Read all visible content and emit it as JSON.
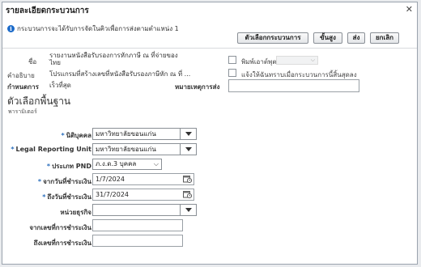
{
  "dialog": {
    "title": "รายละเอียดกระบวนการ",
    "close_glyph": "✕"
  },
  "info": {
    "icon_glyph": "i",
    "text": "กระบวนการจะได้รับการจัดในคิวเพื่อการส่งตามตำแหน่ง 1"
  },
  "buttons": {
    "process_options": "ตัวเลือกกระบวนการ",
    "advanced": "ขั้นสูง",
    "submit": "ส่ง",
    "cancel": "ยกเลิก"
  },
  "details": {
    "name_label": "ชื่อ",
    "name_value": "รายงานหนังสือรับรองการหักภาษี ณ ที่จ่ายของไทย",
    "description_label": "คำอธิบาย",
    "description_value": "โปรแกรมที่สร้างเลขที่หนังสือรับรองภาษีหัก ณ ที่ ...",
    "schedule_label": "กำหนดการ",
    "schedule_value": "เร็วที่สุด",
    "print_output_label": "พิมพ์เอาต์พุต",
    "notify_label": "แจ้งให้ฉันทราบเมื่อกระบวนการนี้สิ้นสุดลง",
    "submission_notes_label": "หมายเหตุการส่ง",
    "submission_notes_value": ""
  },
  "basic_options": {
    "title": "ตัวเลือกพื้นฐาน",
    "subtitle": "พารามิเตอร์"
  },
  "params": {
    "required_marker": "*",
    "legal_entity_label": "นิติบุคคล",
    "legal_entity_value": "มหาวิทยาลัยขอนแก่น",
    "lru_label": "Legal Reporting Unit",
    "lru_value": "มหาวิทยาลัยขอนแก่น",
    "pnd_type_label": "ประเภท PND",
    "pnd_type_value": "ภ.ง.ด.3 บุคคล",
    "from_payment_date_label": "จากวันที่ชำระเงิน",
    "from_payment_date_value": "1/7/2024",
    "to_payment_date_label": "ถึงวันที่ชำระเงิน",
    "to_payment_date_value": "31/7/2024",
    "business_unit_label": "หน่วยธุรกิจ",
    "business_unit_value": "",
    "from_payment_no_label": "จากเลขที่การชำระเงิน",
    "from_payment_no_value": "",
    "to_payment_no_label": "ถึงเลขที่การชำระเงิน",
    "to_payment_no_value": ""
  },
  "colors": {
    "accent_blue": "#1b6ac9",
    "required_blue": "#2b6fbd"
  }
}
